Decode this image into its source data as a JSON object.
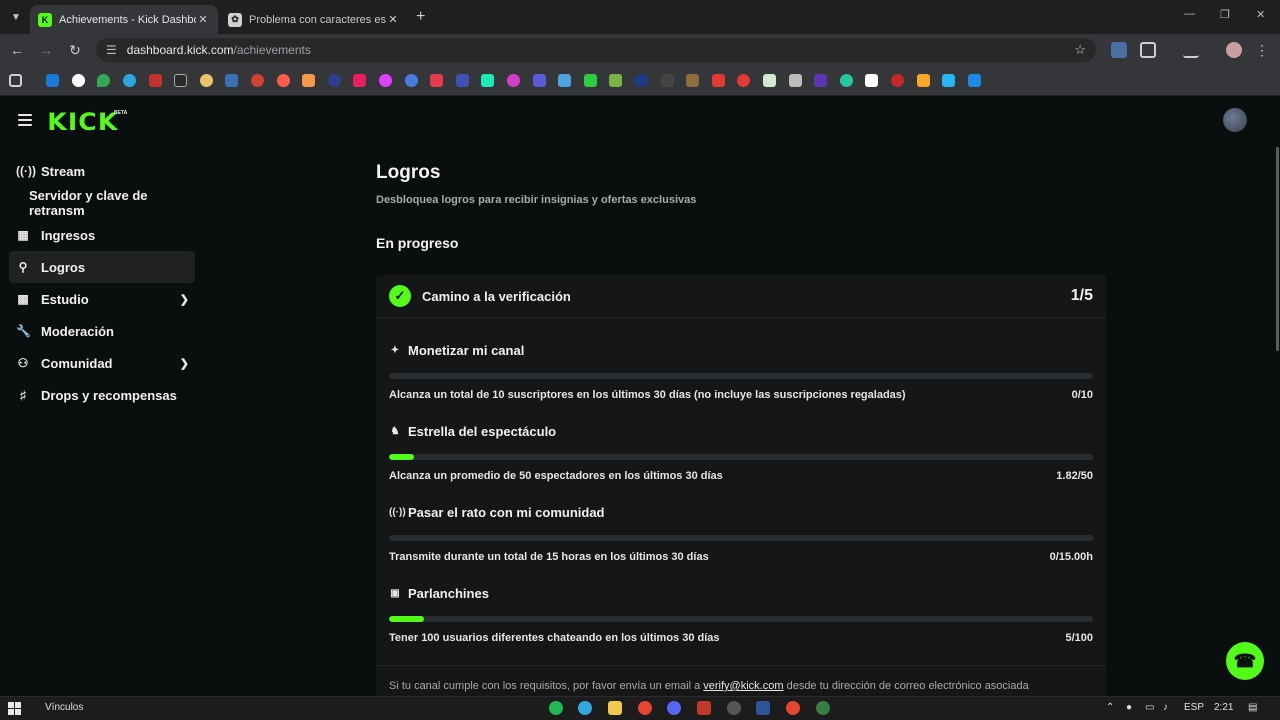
{
  "browser": {
    "tabs": [
      {
        "title": "Achievements - Kick Dashboard",
        "active": true
      },
      {
        "title": "Problema con caracteres especiales",
        "active": false
      }
    ],
    "url_host": "dashboard.kick.com",
    "url_path": "/achievements"
  },
  "brand": {
    "logo": "KICK",
    "badge": "BETA",
    "accent": "#53fc18"
  },
  "sidebar": {
    "items": [
      {
        "label": "Stream",
        "icon": "broadcast-icon"
      },
      {
        "label": "Servidor y clave de retransm",
        "icon": ""
      },
      {
        "label": "Ingresos",
        "icon": "bar-chart-icon"
      },
      {
        "label": "Logros",
        "icon": "trophy-icon"
      },
      {
        "label": "Estudio",
        "icon": "studio-icon"
      },
      {
        "label": "Moderación",
        "icon": "wrench-icon"
      },
      {
        "label": "Comunidad",
        "icon": "people-icon"
      },
      {
        "label": "Drops y recompensas",
        "icon": "gift-icon"
      }
    ]
  },
  "main": {
    "title": "Logros",
    "subtitle": "Desbloquea logros para recibir insignias y ofertas exclusivas",
    "section": "En progreso",
    "card": {
      "title": "Camino a la verificación",
      "count": "1/5",
      "tasks": [
        {
          "title": "Monetizar mi canal",
          "icon": "sparkle-icon",
          "desc": "Alcanza un total de 10 suscriptores en los últimos 30 días (no incluye las suscripciones regaladas)",
          "value": "0/10",
          "progress": 0.0
        },
        {
          "title": "Estrella del espectáculo",
          "icon": "viewers-icon",
          "desc": "Alcanza un promedio de 50 espectadores en los últimos 30 días",
          "value": "1.82/50",
          "progress": 0.036
        },
        {
          "title": "Pasar el rato con mi comunidad",
          "icon": "broadcast-icon",
          "desc": "Transmite durante un total de 15 horas en los últimos 30 días",
          "value": "0/15.00h",
          "progress": 0.0
        },
        {
          "title": "Parlanchines",
          "icon": "chat-icon",
          "desc": "Tener 100 usuarios diferentes chateando en los últimos 30 días",
          "value": "5/100",
          "progress": 0.05
        }
      ],
      "footer_pre": "Si tu canal cumple con los requisitos, por favor envía un email a",
      "footer_email": "verify@kick.com",
      "footer_post": "desde tu dirección de correo electrónico asociada"
    }
  },
  "taskbar": {
    "links_label": "Vínculos",
    "lang": "ESP",
    "time": "2:21"
  }
}
